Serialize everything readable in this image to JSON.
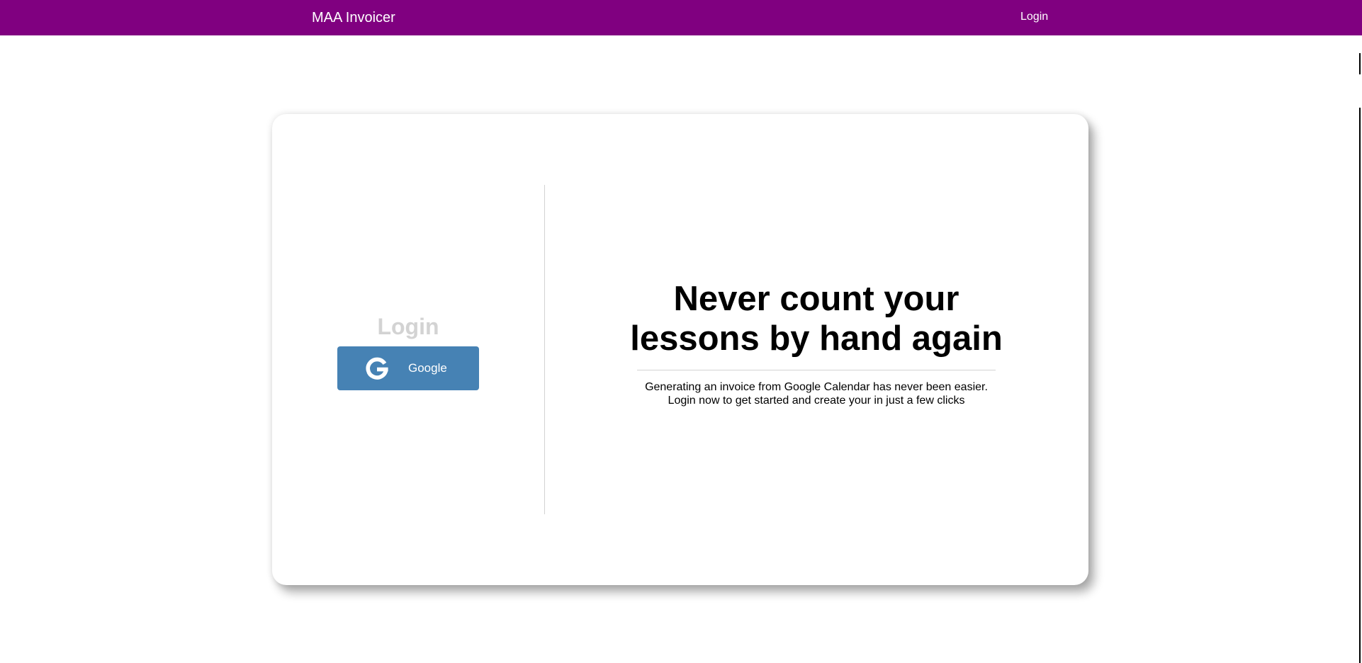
{
  "colors": {
    "navbar_bg": "#800080",
    "google_button_bg": "#4682b4",
    "login_heading": "#d3d3d3"
  },
  "navbar": {
    "brand": "MAA Invoicer",
    "login_link": "Login"
  },
  "login_panel": {
    "heading": "Login",
    "google_button": {
      "icon": "google-g-icon",
      "label": "Google"
    }
  },
  "hero": {
    "headline": "Never count your lessons by hand again",
    "subtext_line1": "Generating an invoice from Google Calendar has never been easier.",
    "subtext_line2": "Login now to get started and create your in just a few clicks"
  }
}
